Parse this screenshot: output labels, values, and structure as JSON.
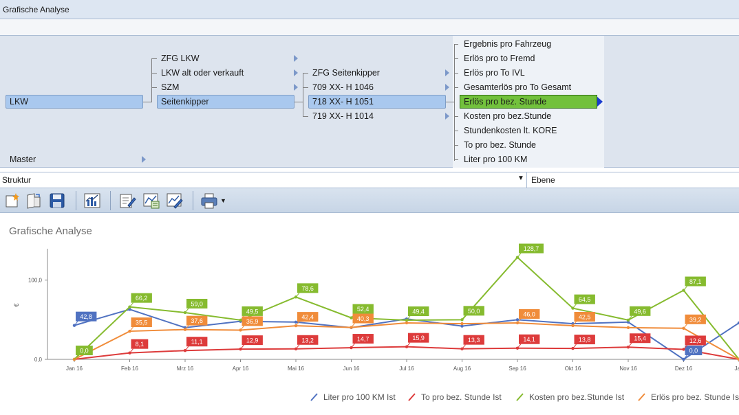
{
  "window": {
    "title": "Grafische Analyse"
  },
  "tree": {
    "root": "LKW",
    "master": "Master",
    "level1": [
      "ZFG LKW",
      "LKW alt oder verkauft",
      "SZM",
      "Seitenkipper"
    ],
    "level1_selected": "Seitenkipper",
    "level2": [
      "ZFG Seitenkipper",
      "709 XX- H 1046",
      "718 XX- H 1051",
      "719 XX- H 1014"
    ],
    "level2_selected": "718 XX- H 1051",
    "level3": [
      "Ergebnis pro Fahrzeug",
      "Erlös pro to Fremd",
      "Erlös pro To IVL",
      "Gesamterlös pro To Gesamt",
      "Erlös pro bez. Stunde",
      "Kosten pro bez.Stunde",
      "Stundenkosten lt. KORE",
      "To pro bez. Stunde",
      "Liter pro 100 KM"
    ],
    "level3_selected": "Erlös pro bez. Stunde"
  },
  "struktur": {
    "label": "Struktur",
    "ebene": "Ebene"
  },
  "toolbar_icons": [
    "new-icon",
    "copy-icon",
    "save-icon",
    "chart-icon",
    "edit-icon",
    "chart-export-icon",
    "chart-edit-icon",
    "print-icon"
  ],
  "chart_title": "Grafische Analyse",
  "chart_data": {
    "type": "line",
    "ylabel": "€",
    "ylim": [
      0,
      150
    ],
    "yticks": [
      "0,0",
      "100,0"
    ],
    "categories": [
      "Jan 16",
      "Feb 16",
      "Mrz 16",
      "Apr 16",
      "Mai 16",
      "Jun 16",
      "Jul 16",
      "Aug 16",
      "Sep 16",
      "Okt 16",
      "Nov 16",
      "Dez 16",
      "Jan"
    ],
    "series": [
      {
        "name": "Liter pro 100 KM Ist",
        "color": "#5072c1",
        "values": [
          42.8,
          63,
          40,
          48,
          47,
          40,
          51,
          42,
          50,
          45,
          47,
          0.0,
          46
        ],
        "labels": [
          "42,8",
          "",
          "",
          "",
          "",
          "",
          "",
          "",
          "",
          "",
          "",
          "0,0",
          ""
        ]
      },
      {
        "name": "To pro bez. Stunde Ist",
        "color": "#dd3b3b",
        "values": [
          0,
          8.1,
          11.1,
          12.9,
          13.2,
          14.7,
          15.9,
          13.3,
          14.1,
          13.8,
          15.4,
          12.6,
          0
        ],
        "labels": [
          "",
          "8,1",
          "11,1",
          "12,9",
          "13,2",
          "14,7",
          "15,9",
          "13,3",
          "14,1",
          "13,8",
          "15,4",
          "12,6",
          ""
        ]
      },
      {
        "name": "Kosten pro bez.Stunde Ist",
        "color": "#86bb2f",
        "values": [
          0.0,
          66.2,
          59.0,
          49.5,
          78.6,
          52.4,
          49.4,
          50.0,
          128.7,
          64.5,
          49.6,
          87.1,
          0
        ],
        "labels": [
          "0,0",
          "66,2",
          "59,0",
          "49,5",
          "78,6",
          "52,4",
          "49,4",
          "50,0",
          "128,7",
          "64,5",
          "49,6",
          "87,1",
          ""
        ]
      },
      {
        "name": "Erlös pro bez. Stunde Ist",
        "color": "#f08c3a",
        "values": [
          0,
          35.5,
          37.6,
          36.9,
          42.4,
          40.3,
          46,
          45,
          46.0,
          42.5,
          40,
          39.2,
          0
        ],
        "labels": [
          "",
          "35,5",
          "37,6",
          "36,9",
          "42,4",
          "40,3",
          "",
          "",
          "46,0",
          "42,5",
          "",
          "39,2",
          ""
        ]
      }
    ]
  }
}
